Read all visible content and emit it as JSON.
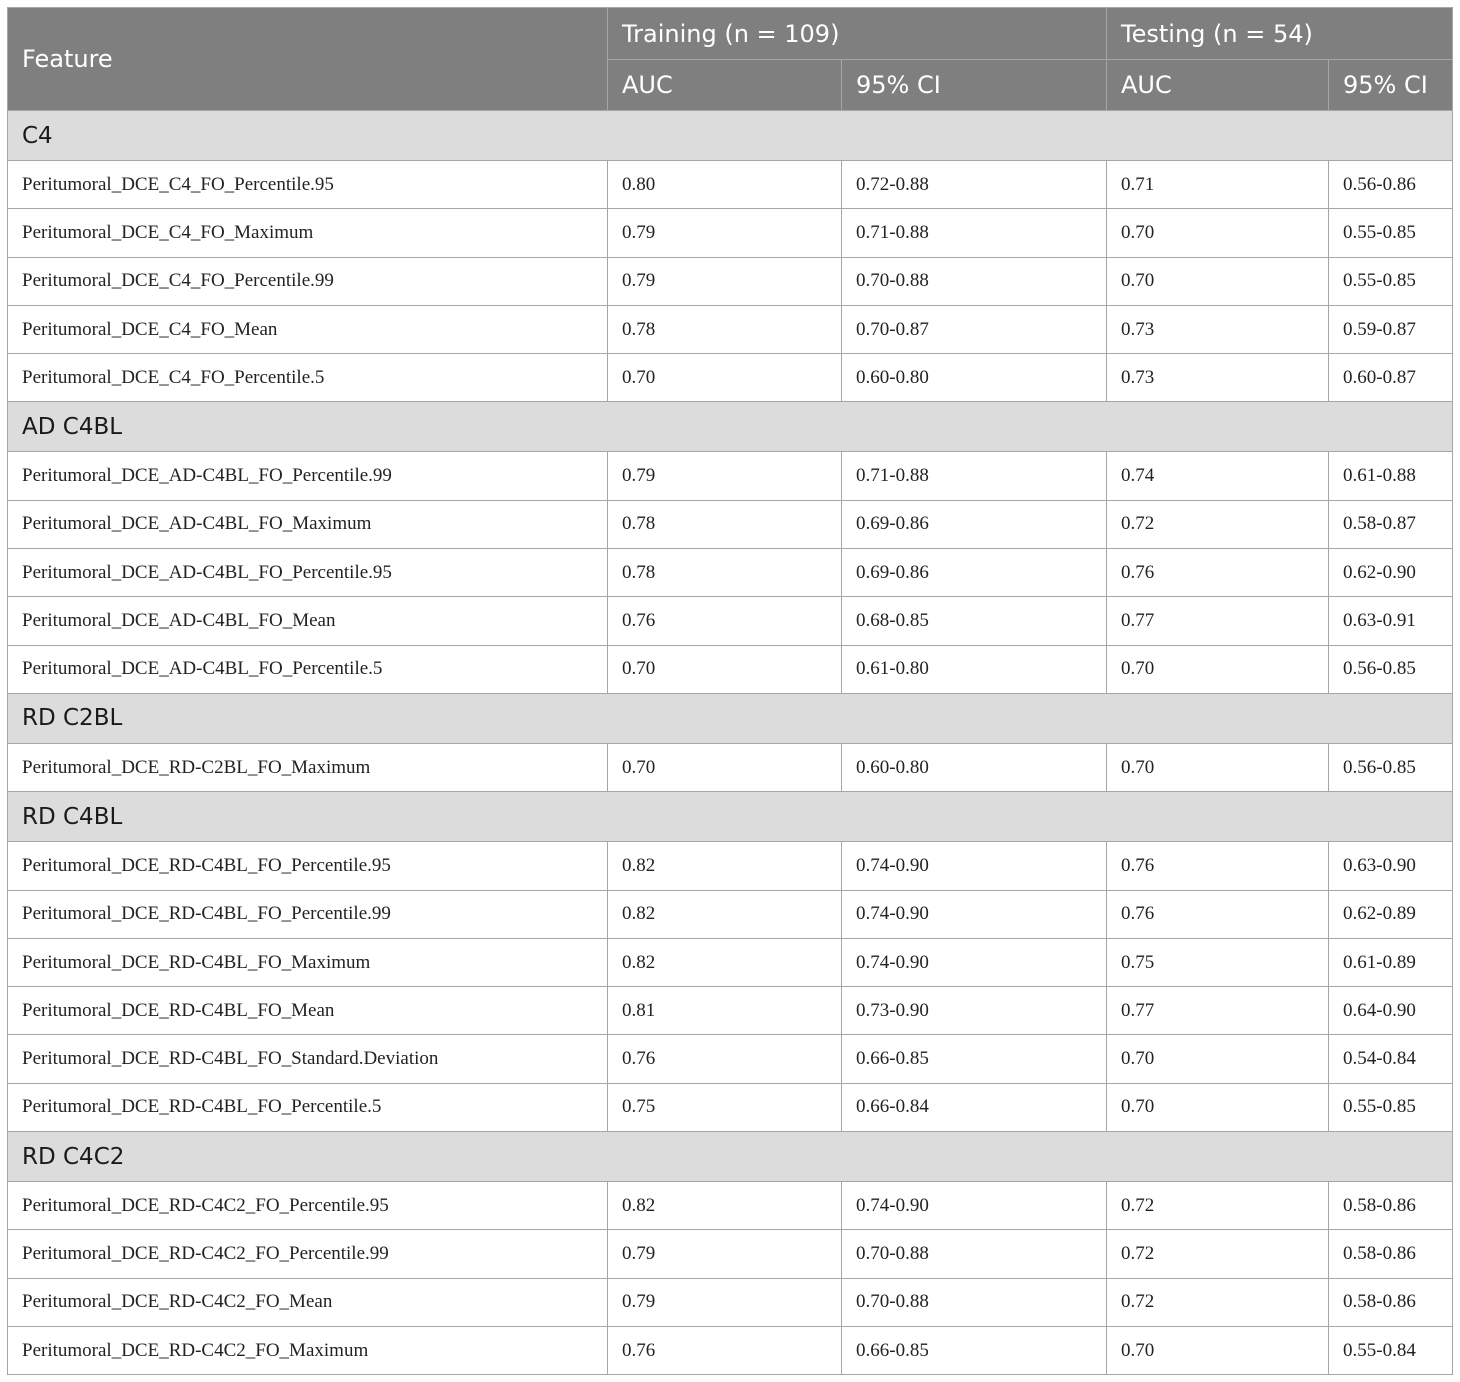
{
  "header": {
    "feature": "Feature",
    "training": "Training (n = 109)",
    "testing": "Testing (n = 54)",
    "training_auc": "AUC",
    "training_ci": "95% CI",
    "testing_auc": "AUC",
    "testing_ci": "95% CI"
  },
  "groups": [
    {
      "name": "C4",
      "rows": [
        {
          "feature": "Peritumoral_DCE_C4_FO_Percentile.95",
          "train_auc": "0.80",
          "train_ci": "0.72-0.88",
          "test_auc": "0.71",
          "test_ci": "0.56-0.86"
        },
        {
          "feature": "Peritumoral_DCE_C4_FO_Maximum",
          "train_auc": "0.79",
          "train_ci": "0.71-0.88",
          "test_auc": "0.70",
          "test_ci": "0.55-0.85"
        },
        {
          "feature": "Peritumoral_DCE_C4_FO_Percentile.99",
          "train_auc": "0.79",
          "train_ci": "0.70-0.88",
          "test_auc": "0.70",
          "test_ci": "0.55-0.85"
        },
        {
          "feature": "Peritumoral_DCE_C4_FO_Mean",
          "train_auc": "0.78",
          "train_ci": "0.70-0.87",
          "test_auc": "0.73",
          "test_ci": "0.59-0.87"
        },
        {
          "feature": "Peritumoral_DCE_C4_FO_Percentile.5",
          "train_auc": "0.70",
          "train_ci": "0.60-0.80",
          "test_auc": "0.73",
          "test_ci": "0.60-0.87"
        }
      ]
    },
    {
      "name": "AD C4BL",
      "rows": [
        {
          "feature": "Peritumoral_DCE_AD-C4BL_FO_Percentile.99",
          "train_auc": "0.79",
          "train_ci": "0.71-0.88",
          "test_auc": "0.74",
          "test_ci": "0.61-0.88"
        },
        {
          "feature": "Peritumoral_DCE_AD-C4BL_FO_Maximum",
          "train_auc": "0.78",
          "train_ci": "0.69-0.86",
          "test_auc": "0.72",
          "test_ci": "0.58-0.87"
        },
        {
          "feature": "Peritumoral_DCE_AD-C4BL_FO_Percentile.95",
          "train_auc": "0.78",
          "train_ci": "0.69-0.86",
          "test_auc": "0.76",
          "test_ci": "0.62-0.90"
        },
        {
          "feature": "Peritumoral_DCE_AD-C4BL_FO_Mean",
          "train_auc": "0.76",
          "train_ci": "0.68-0.85",
          "test_auc": "0.77",
          "test_ci": "0.63-0.91"
        },
        {
          "feature": "Peritumoral_DCE_AD-C4BL_FO_Percentile.5",
          "train_auc": "0.70",
          "train_ci": "0.61-0.80",
          "test_auc": "0.70",
          "test_ci": "0.56-0.85"
        }
      ]
    },
    {
      "name": "RD C2BL",
      "rows": [
        {
          "feature": "Peritumoral_DCE_RD-C2BL_FO_Maximum",
          "train_auc": "0.70",
          "train_ci": "0.60-0.80",
          "test_auc": "0.70",
          "test_ci": "0.56-0.85"
        }
      ]
    },
    {
      "name": "RD C4BL",
      "rows": [
        {
          "feature": "Peritumoral_DCE_RD-C4BL_FO_Percentile.95",
          "train_auc": "0.82",
          "train_ci": "0.74-0.90",
          "test_auc": "0.76",
          "test_ci": "0.63-0.90"
        },
        {
          "feature": "Peritumoral_DCE_RD-C4BL_FO_Percentile.99",
          "train_auc": "0.82",
          "train_ci": "0.74-0.90",
          "test_auc": "0.76",
          "test_ci": "0.62-0.89"
        },
        {
          "feature": "Peritumoral_DCE_RD-C4BL_FO_Maximum",
          "train_auc": "0.82",
          "train_ci": "0.74-0.90",
          "test_auc": "0.75",
          "test_ci": "0.61-0.89"
        },
        {
          "feature": "Peritumoral_DCE_RD-C4BL_FO_Mean",
          "train_auc": "0.81",
          "train_ci": "0.73-0.90",
          "test_auc": "0.77",
          "test_ci": "0.64-0.90"
        },
        {
          "feature": "Peritumoral_DCE_RD-C4BL_FO_Standard.Deviation",
          "train_auc": "0.76",
          "train_ci": "0.66-0.85",
          "test_auc": "0.70",
          "test_ci": "0.54-0.84"
        },
        {
          "feature": "Peritumoral_DCE_RD-C4BL_FO_Percentile.5",
          "train_auc": "0.75",
          "train_ci": "0.66-0.84",
          "test_auc": "0.70",
          "test_ci": "0.55-0.85"
        }
      ]
    },
    {
      "name": "RD C4C2",
      "rows": [
        {
          "feature": "Peritumoral_DCE_RD-C4C2_FO_Percentile.95",
          "train_auc": "0.82",
          "train_ci": "0.74-0.90",
          "test_auc": "0.72",
          "test_ci": "0.58-0.86"
        },
        {
          "feature": "Peritumoral_DCE_RD-C4C2_FO_Percentile.99",
          "train_auc": "0.79",
          "train_ci": "0.70-0.88",
          "test_auc": "0.72",
          "test_ci": "0.58-0.86"
        },
        {
          "feature": "Peritumoral_DCE_RD-C4C2_FO_Mean",
          "train_auc": "0.79",
          "train_ci": "0.70-0.88",
          "test_auc": "0.72",
          "test_ci": "0.58-0.86"
        },
        {
          "feature": "Peritumoral_DCE_RD-C4C2_FO_Maximum",
          "train_auc": "0.76",
          "train_ci": "0.66-0.85",
          "test_auc": "0.70",
          "test_ci": "0.55-0.84"
        }
      ]
    }
  ]
}
